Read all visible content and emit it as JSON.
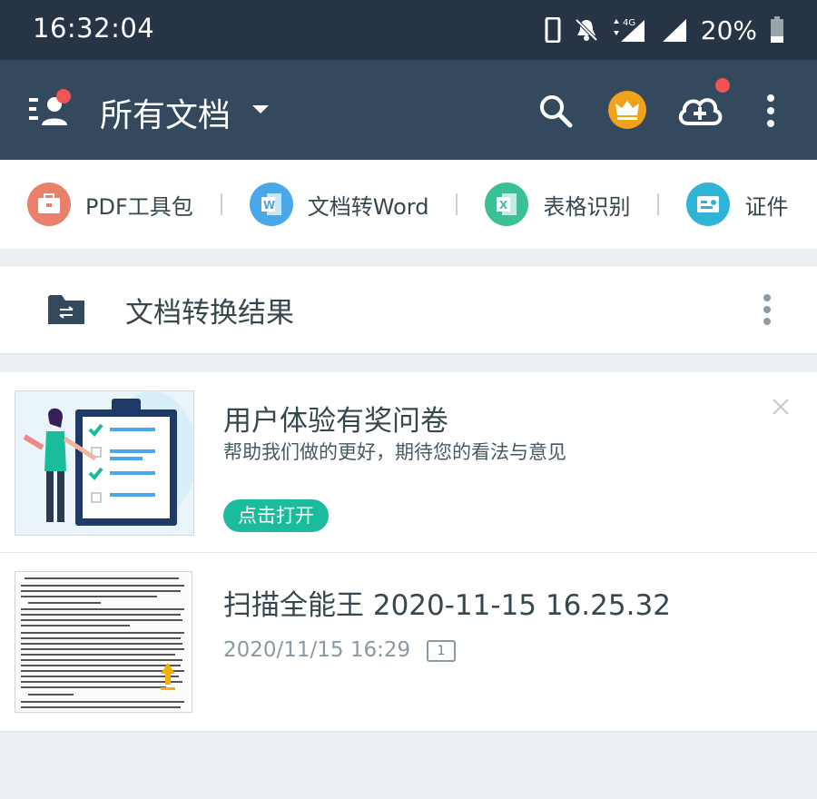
{
  "status_bar": {
    "time": "16:32:04",
    "network": "4G",
    "battery": "20%",
    "icons": [
      "phone-icon",
      "mute-bell-icon",
      "signal-4g-icon",
      "signal-icon",
      "battery-icon"
    ]
  },
  "app_bar": {
    "title": "所有文档",
    "icons": [
      "menu-icon",
      "dropdown-caret-icon",
      "search-icon",
      "crown-icon",
      "cloud-upload-icon",
      "more-icon"
    ],
    "notification_color": "#f25454"
  },
  "tools": [
    {
      "label": "PDF工具包",
      "icon": "toolbox-icon",
      "color": "#e8806c"
    },
    {
      "label": "文档转Word",
      "icon": "word-icon",
      "color": "#4aa8e8"
    },
    {
      "label": "表格识别",
      "icon": "excel-icon",
      "color": "#3bbf96"
    },
    {
      "label": "证件",
      "icon": "id-card-icon",
      "color": "#2fb4d6"
    }
  ],
  "folder": {
    "title": "文档转换结果",
    "icon": "convert-folder-icon"
  },
  "survey": {
    "title": "用户体验有奖问卷",
    "subtitle": "帮助我们做的更好，期待您的看法与意见",
    "button": "点击打开",
    "button_color": "#1bbc9b"
  },
  "document": {
    "title": "扫描全能王 2020-11-15 16.25.32",
    "date": "2020/11/15 16:29",
    "pages": "1"
  },
  "colors": {
    "status_bar": "#263445",
    "app_bar": "#34495e",
    "background": "#eceff1"
  }
}
